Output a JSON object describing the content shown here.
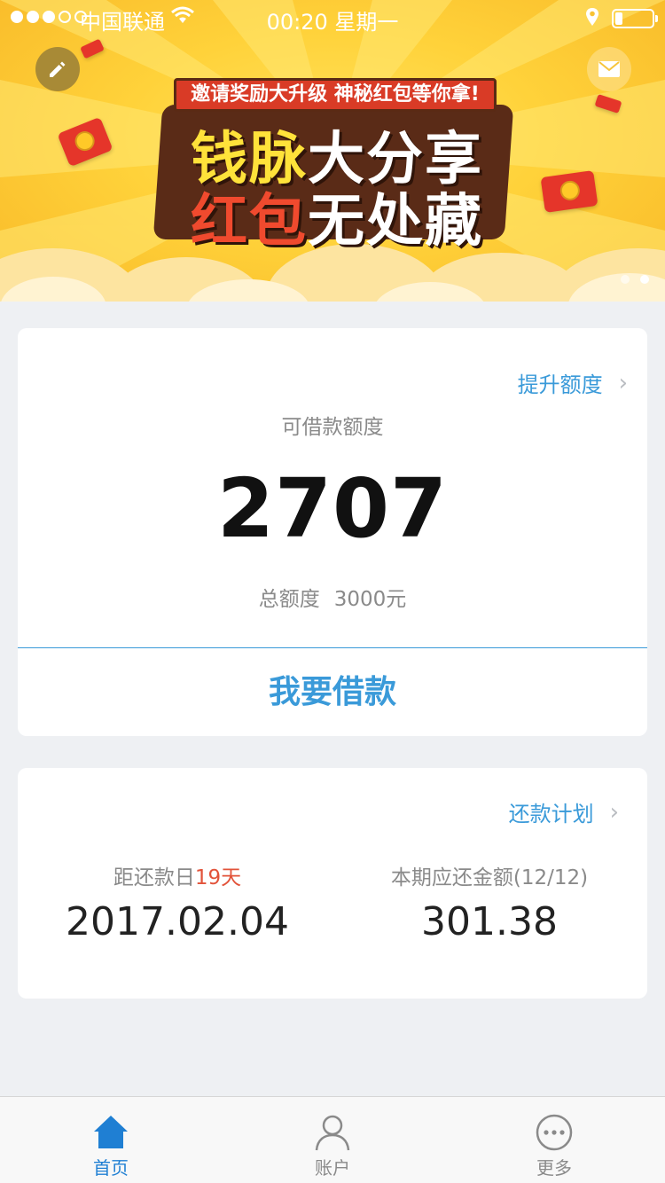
{
  "status_bar": {
    "carrier": "中国联通",
    "time": "00:20 星期一"
  },
  "banner": {
    "ribbon_text": "邀请奖励大升级  神秘红包等你拿!",
    "title_line1_a": "钱脉",
    "title_line1_b": "大分享",
    "title_line2_a": "红包",
    "title_line2_b": "无处藏"
  },
  "credit": {
    "raise_link": "提升额度",
    "limit_label": "可借款额度",
    "limit_value": "2707",
    "total_label": "总额度",
    "total_value": "3000元",
    "borrow_button": "我要借款"
  },
  "repayment": {
    "plan_link": "还款计划",
    "due_label": "距还款日",
    "due_days": "19天",
    "due_date": "2017.02.04",
    "amount_label": "本期应还金额(12/12)",
    "amount_value": "301.38"
  },
  "tabbar": {
    "home": "首页",
    "account": "账户",
    "more": "更多"
  },
  "colors": {
    "accent": "#3a9ad9",
    "tab_active": "#1f7fd3",
    "highlight": "#e2533a",
    "banner": "#ffd23a"
  }
}
